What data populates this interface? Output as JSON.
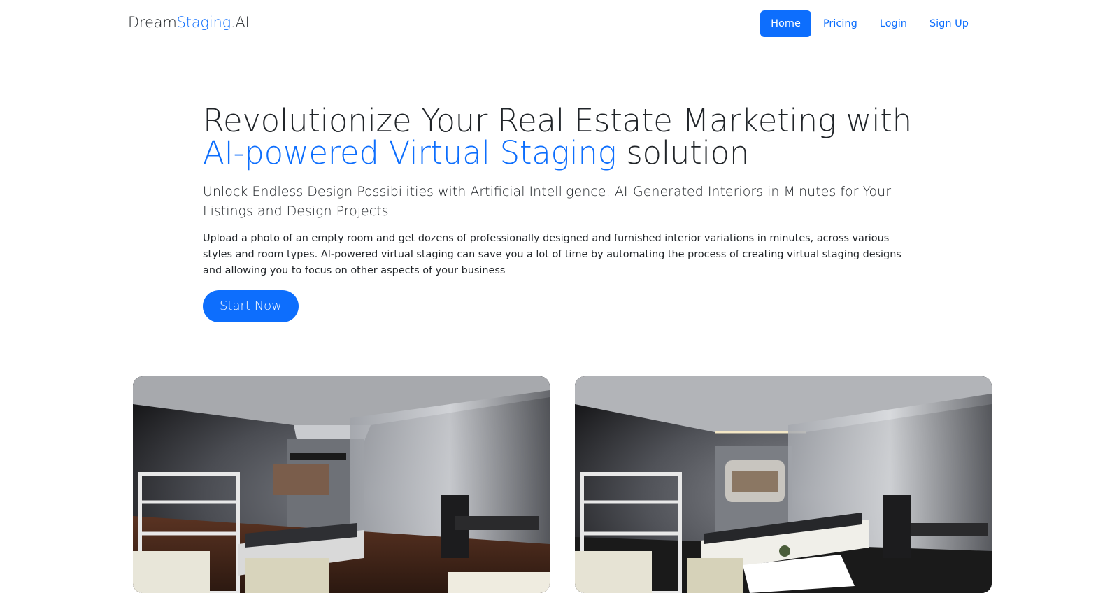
{
  "brand": {
    "part1": "Dream",
    "part2": "Staging",
    "part3": ".AI"
  },
  "nav": {
    "items": [
      {
        "label": "Home",
        "active": true
      },
      {
        "label": "Pricing",
        "active": false
      },
      {
        "label": "Login",
        "active": false
      },
      {
        "label": "Sign Up",
        "active": false
      }
    ]
  },
  "hero": {
    "headline_start": "Revolutionize Your Real Estate Marketing with ",
    "headline_highlight": "AI-powered Virtual Staging",
    "headline_end": " solution",
    "lead": "Unlock Endless Design Possibilities with Artificial Intelligence: AI-Generated Interiors in Minutes for Your Listings and Design Projects",
    "body": "Upload a photo of an empty room and get dozens of professionally designed and furnished interior variations in minutes, across various styles and room types. AI-powered virtual staging can save you a lot of time by automating the process of creating virtual staging designs and allowing you to focus on other aspects of your business",
    "cta_label": "Start Now"
  },
  "images": [
    {
      "name": "before-room-photo"
    },
    {
      "name": "after-staged-room-photo"
    }
  ],
  "colors": {
    "accent": "#0d6efd",
    "text": "#212529",
    "background": "#ffffff"
  }
}
